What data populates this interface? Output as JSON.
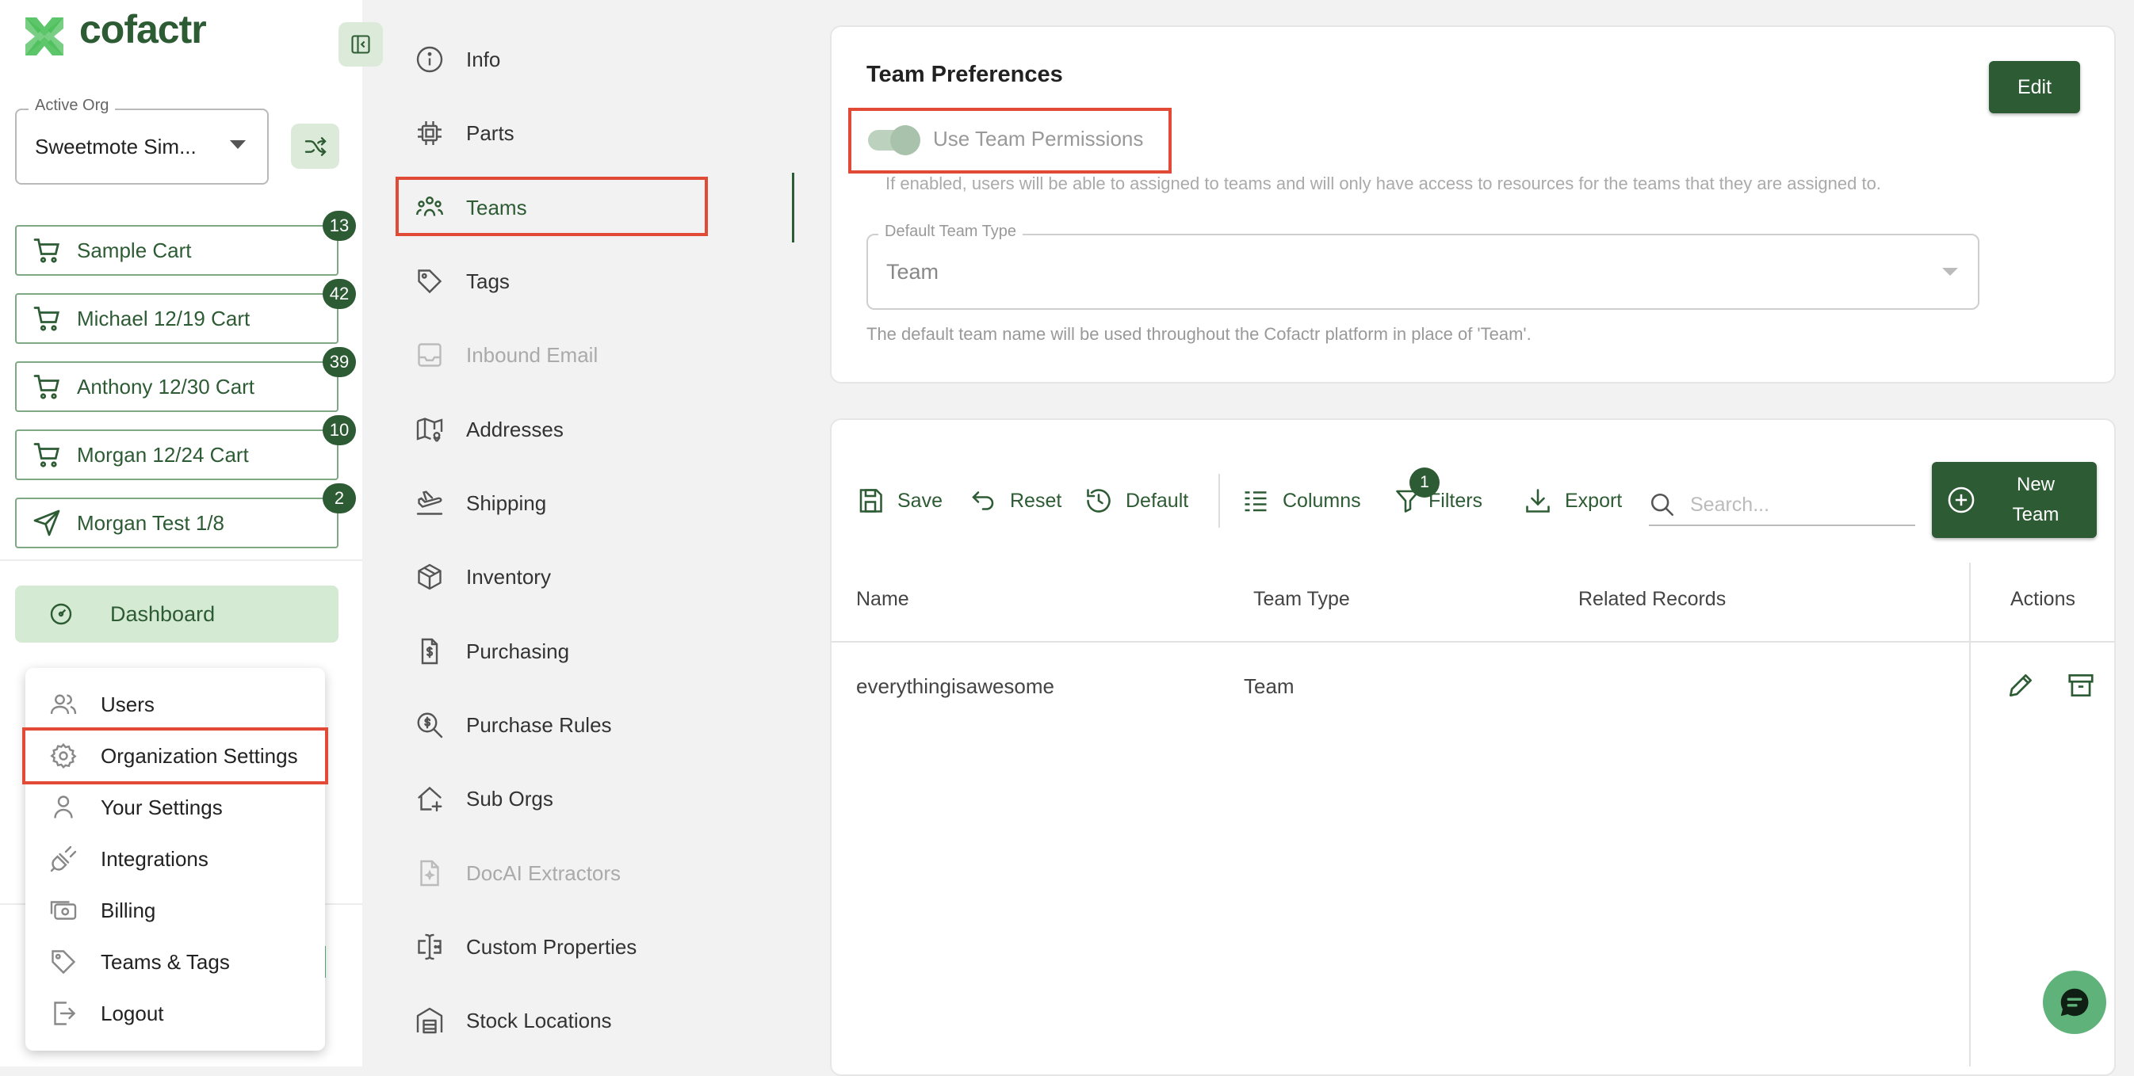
{
  "brand": {
    "name": "cofactr",
    "color": "#2d5b34",
    "accent": "#dcebd9",
    "highlight": "#e04a36"
  },
  "org": {
    "label": "Active Org",
    "value": "Sweetmote Sim..."
  },
  "carts": [
    {
      "label": "Sample Cart",
      "badge": "13",
      "icon": "cart-icon"
    },
    {
      "label": "Michael 12/19 Cart",
      "badge": "42",
      "icon": "cart-icon"
    },
    {
      "label": "Anthony 12/30 Cart",
      "badge": "39",
      "icon": "cart-icon"
    },
    {
      "label": "Morgan 12/24 Cart",
      "badge": "10",
      "icon": "cart-icon"
    },
    {
      "label": "Morgan Test 1/8",
      "badge": "2",
      "icon": "send-icon"
    }
  ],
  "dashboard": {
    "label": "Dashboard"
  },
  "user_menu": {
    "items": [
      {
        "label": "Users",
        "icon": "users-icon"
      },
      {
        "label": "Organization Settings",
        "icon": "gear-icon",
        "highlighted": true
      },
      {
        "label": "Your Settings",
        "icon": "person-icon"
      },
      {
        "label": "Integrations",
        "icon": "plug-icon"
      },
      {
        "label": "Billing",
        "icon": "billing-icon"
      },
      {
        "label": "Teams & Tags",
        "icon": "tag-icon"
      },
      {
        "label": "Logout",
        "icon": "logout-icon"
      }
    ]
  },
  "settings_nav": {
    "items": [
      {
        "label": "Info",
        "icon": "info-icon"
      },
      {
        "label": "Parts",
        "icon": "chip-icon"
      },
      {
        "label": "Teams",
        "icon": "team-icon",
        "active": true
      },
      {
        "label": "Tags",
        "icon": "tag-icon"
      },
      {
        "label": "Inbound Email",
        "icon": "inbox-icon",
        "disabled": true
      },
      {
        "label": "Addresses",
        "icon": "map-icon"
      },
      {
        "label": "Shipping",
        "icon": "plane-icon"
      },
      {
        "label": "Inventory",
        "icon": "box-icon"
      },
      {
        "label": "Purchasing",
        "icon": "dollar-doc-icon"
      },
      {
        "label": "Purchase Rules",
        "icon": "dollar-search-icon"
      },
      {
        "label": "Sub Orgs",
        "icon": "home-plus-icon"
      },
      {
        "label": "DocAI Extractors",
        "icon": "doc-ai-icon",
        "disabled": true
      },
      {
        "label": "Custom Properties",
        "icon": "text-cursor-icon"
      },
      {
        "label": "Stock Locations",
        "icon": "warehouse-icon"
      }
    ]
  },
  "team_prefs": {
    "title": "Team Preferences",
    "edit_label": "Edit",
    "toggle_label": "Use Team Permissions",
    "toggle_help": "If enabled, users will be able to assigned to teams and will only have access to resources for the teams that they are assigned to.",
    "default_type_label": "Default Team Type",
    "default_type_value": "Team",
    "default_type_help": "The default team name will be used throughout the Cofactr platform in place of 'Team'."
  },
  "toolbar": {
    "save": "Save",
    "reset": "Reset",
    "default": "Default",
    "columns": "Columns",
    "filters": "Filters",
    "filters_count": "1",
    "export": "Export",
    "search_placeholder": "Search...",
    "new_team_line1": "New",
    "new_team_line2": "Team"
  },
  "table": {
    "columns": [
      "Name",
      "Team Type",
      "Related Records",
      "Actions"
    ],
    "rows": [
      {
        "name": "everythingisawesome",
        "type": "Team",
        "related": ""
      }
    ]
  }
}
